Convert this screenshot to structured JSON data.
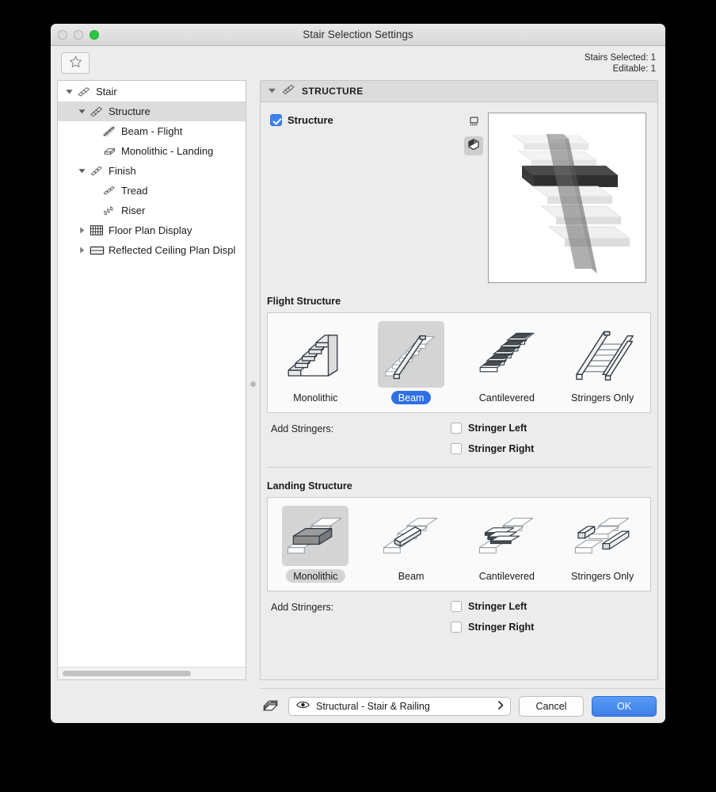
{
  "window": {
    "title": "Stair Selection Settings",
    "traffic_lights": [
      "close-button",
      "minimize-button",
      "zoom-button"
    ],
    "accent_blue": "#2f6fe4",
    "zoom_green": "#28c840"
  },
  "toolbar": {
    "favorites_icon": "star-icon",
    "stairs_selected": "Stairs Selected: 1",
    "editable": "Editable: 1"
  },
  "sidebar": {
    "items": [
      {
        "label": "Stair",
        "icon": "stair-icon",
        "depth": 0,
        "twisty": "down",
        "selected": false
      },
      {
        "label": "Structure",
        "icon": "structure-icon",
        "depth": 1,
        "twisty": "down",
        "selected": true
      },
      {
        "label": "Beam - Flight",
        "icon": "beam-flight-icon",
        "depth": 2,
        "twisty": "none",
        "selected": false
      },
      {
        "label": "Monolithic - Landing",
        "icon": "monolithic-landing-icon",
        "depth": 2,
        "twisty": "none",
        "selected": false
      },
      {
        "label": "Finish",
        "icon": "finish-icon",
        "depth": 1,
        "twisty": "down",
        "selected": false
      },
      {
        "label": "Tread",
        "icon": "tread-icon",
        "depth": 2,
        "twisty": "none",
        "selected": false
      },
      {
        "label": "Riser",
        "icon": "riser-icon",
        "depth": 2,
        "twisty": "none",
        "selected": false
      },
      {
        "label": "Floor Plan Display",
        "icon": "floor-plan-icon",
        "depth": 1,
        "twisty": "right",
        "selected": false
      },
      {
        "label": "Reflected Ceiling Plan Displ",
        "icon": "reflected-ceiling-icon",
        "depth": 1,
        "twisty": "right",
        "selected": false
      }
    ]
  },
  "section": {
    "header_title": "STRUCTURE",
    "header_icon": "structure-icon",
    "header_twisty": "down"
  },
  "structure": {
    "checkbox_label": "Structure",
    "checkbox_checked": true,
    "preview_tools": [
      {
        "name": "floor-plan-view-icon",
        "active": false
      },
      {
        "name": "3d-view-icon",
        "active": true
      }
    ],
    "preview_alt": "3D stair structure preview with beam"
  },
  "flight_structure": {
    "title": "Flight Structure",
    "options": [
      {
        "label": "Monolithic",
        "icon": "stair-monolithic-icon",
        "selected": false
      },
      {
        "label": "Beam",
        "icon": "stair-beam-icon",
        "selected": true
      },
      {
        "label": "Cantilevered",
        "icon": "stair-cantilevered-icon",
        "selected": false
      },
      {
        "label": "Stringers Only",
        "icon": "stair-stringers-only-icon",
        "selected": false
      }
    ],
    "add_stringers_label": "Add Stringers:",
    "stringers": [
      {
        "label": "Stringer Left",
        "checked": false
      },
      {
        "label": "Stringer Right",
        "checked": false
      }
    ]
  },
  "landing_structure": {
    "title": "Landing Structure",
    "options": [
      {
        "label": "Monolithic",
        "icon": "landing-monolithic-icon",
        "selected": true
      },
      {
        "label": "Beam",
        "icon": "landing-beam-icon",
        "selected": false
      },
      {
        "label": "Cantilevered",
        "icon": "landing-cantilevered-icon",
        "selected": false
      },
      {
        "label": "Stringers Only",
        "icon": "landing-stringers-only-icon",
        "selected": false
      }
    ],
    "add_stringers_label": "Add Stringers:",
    "stringers": [
      {
        "label": "Stringer Left",
        "checked": false
      },
      {
        "label": "Stringer Right",
        "checked": false
      }
    ]
  },
  "footer": {
    "layers_icon": "layers-icon",
    "pen_set_icon": "eye-icon",
    "pen_set_value": "Structural - Stair & Railing",
    "pen_set_chevron": "chevron-right-icon",
    "cancel_label": "Cancel",
    "ok_label": "OK"
  }
}
